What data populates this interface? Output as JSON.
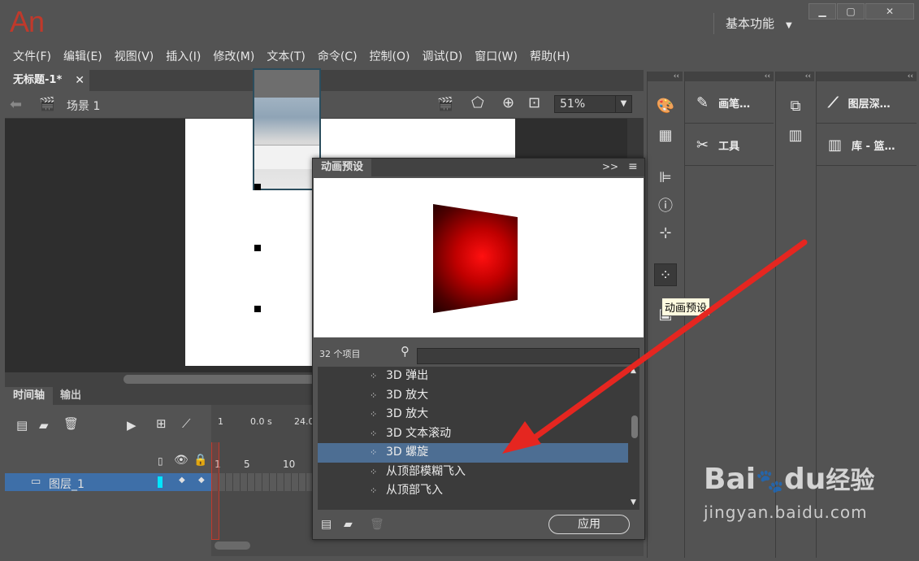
{
  "app": {
    "logo": "An",
    "workspace": "基本功能"
  },
  "window_controls": {
    "minimize": "▁",
    "maximize": "▢",
    "close": "✕"
  },
  "menu": [
    "文件(F)",
    "编辑(E)",
    "视图(V)",
    "插入(I)",
    "修改(M)",
    "文本(T)",
    "命令(C)",
    "控制(O)",
    "调试(D)",
    "窗口(W)",
    "帮助(H)"
  ],
  "document": {
    "tab_title": "无标题-1*",
    "close": "✕",
    "scene": "场景 1",
    "zoom": "51%"
  },
  "timeline": {
    "tabs": [
      "时间轴",
      "输出"
    ],
    "frame_marks": {
      "start": "1",
      "time": "0.0 s",
      "fps": "24.0"
    },
    "ruler": [
      "1",
      "5",
      "10"
    ],
    "layer_name": "图层_1"
  },
  "motion_presets": {
    "title": "动画预设",
    "count": "32 个项目",
    "search_value": "",
    "items": [
      {
        "label": "3D 弹出",
        "selected": false
      },
      {
        "label": "3D 放大",
        "selected": false
      },
      {
        "label": "3D 放大",
        "selected": false
      },
      {
        "label": "3D 文本滚动",
        "selected": false
      },
      {
        "label": "3D 螺旋",
        "selected": true
      },
      {
        "label": "从顶部模糊飞入",
        "selected": false
      },
      {
        "label": "从顶部飞入",
        "selected": false
      }
    ],
    "apply_label": "应用"
  },
  "tooltip": "动画预设",
  "right_panels": {
    "col2": [
      {
        "label": "画笔…"
      },
      {
        "label": "工具"
      }
    ],
    "col4": [
      {
        "label": "图层深…"
      },
      {
        "label": "库 - 篮…"
      }
    ],
    "collapse": "‹‹"
  },
  "watermark": {
    "brand_bai": "Bai",
    "brand_du": "du",
    "brand_cn": "经验",
    "url": "jingyan.baidu.com"
  },
  "colors": {
    "accent_red": "#e52620",
    "selection_blue": "#3e6fa8",
    "logo": "#c0392b"
  }
}
